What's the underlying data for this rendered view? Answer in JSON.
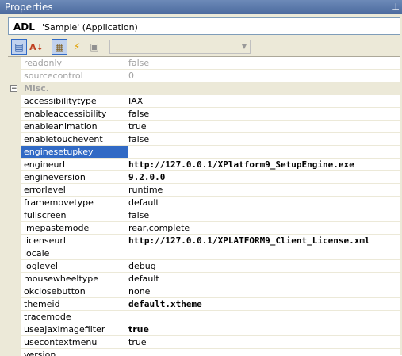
{
  "window": {
    "title": "Properties",
    "pin_icon": "pin-icon"
  },
  "object": {
    "name": "ADL",
    "type": "'Sample' (Application)"
  },
  "toolbar": {
    "buttons": [
      {
        "name": "categorized-button",
        "glyph": "▤"
      },
      {
        "name": "alphabetical-button",
        "glyph": "A↓"
      },
      {
        "name": "property-pages-button",
        "glyph": "▦"
      },
      {
        "name": "events-button",
        "glyph": "⚡"
      },
      {
        "name": "settings-button",
        "glyph": "▣"
      }
    ],
    "dropdown_value": ""
  },
  "grid": {
    "rows_top": [
      {
        "name": "readonly",
        "value": "false",
        "disabled": true
      },
      {
        "name": "sourcecontrol",
        "value": "0",
        "disabled": true
      }
    ],
    "category": {
      "toggle": "−",
      "label": "Misc."
    },
    "rows": [
      {
        "name": "accessibilitytype",
        "value": "IAX"
      },
      {
        "name": "enableaccessibility",
        "value": "false"
      },
      {
        "name": "enableanimation",
        "value": "true"
      },
      {
        "name": "enabletouchevent",
        "value": "false"
      },
      {
        "name": "enginesetupkey",
        "value": "",
        "selected": true
      },
      {
        "name": "engineurl",
        "value": "http://127.0.0.1/XPlatform9_SetupEngine.exe",
        "bold": "mono"
      },
      {
        "name": "engineversion",
        "value": "9.2.0.0",
        "bold": "mono"
      },
      {
        "name": "errorlevel",
        "value": "runtime"
      },
      {
        "name": "framemovetype",
        "value": "default"
      },
      {
        "name": "fullscreen",
        "value": "false"
      },
      {
        "name": "imepastemode",
        "value": "rear,complete"
      },
      {
        "name": "licenseurl",
        "value": "http://127.0.0.1/XPLATFORM9_Client_License.xml",
        "bold": "mono"
      },
      {
        "name": "locale",
        "value": ""
      },
      {
        "name": "loglevel",
        "value": "debug"
      },
      {
        "name": "mousewheeltype",
        "value": "default"
      },
      {
        "name": "okclosebutton",
        "value": "none"
      },
      {
        "name": "themeid",
        "value": "default.xtheme",
        "bold": "mono"
      },
      {
        "name": "tracemode",
        "value": ""
      },
      {
        "name": "useajaximagefilter",
        "value": "true",
        "bold": "sans"
      },
      {
        "name": "usecontextmenu",
        "value": "true"
      },
      {
        "name": "version",
        "value": ""
      }
    ]
  }
}
